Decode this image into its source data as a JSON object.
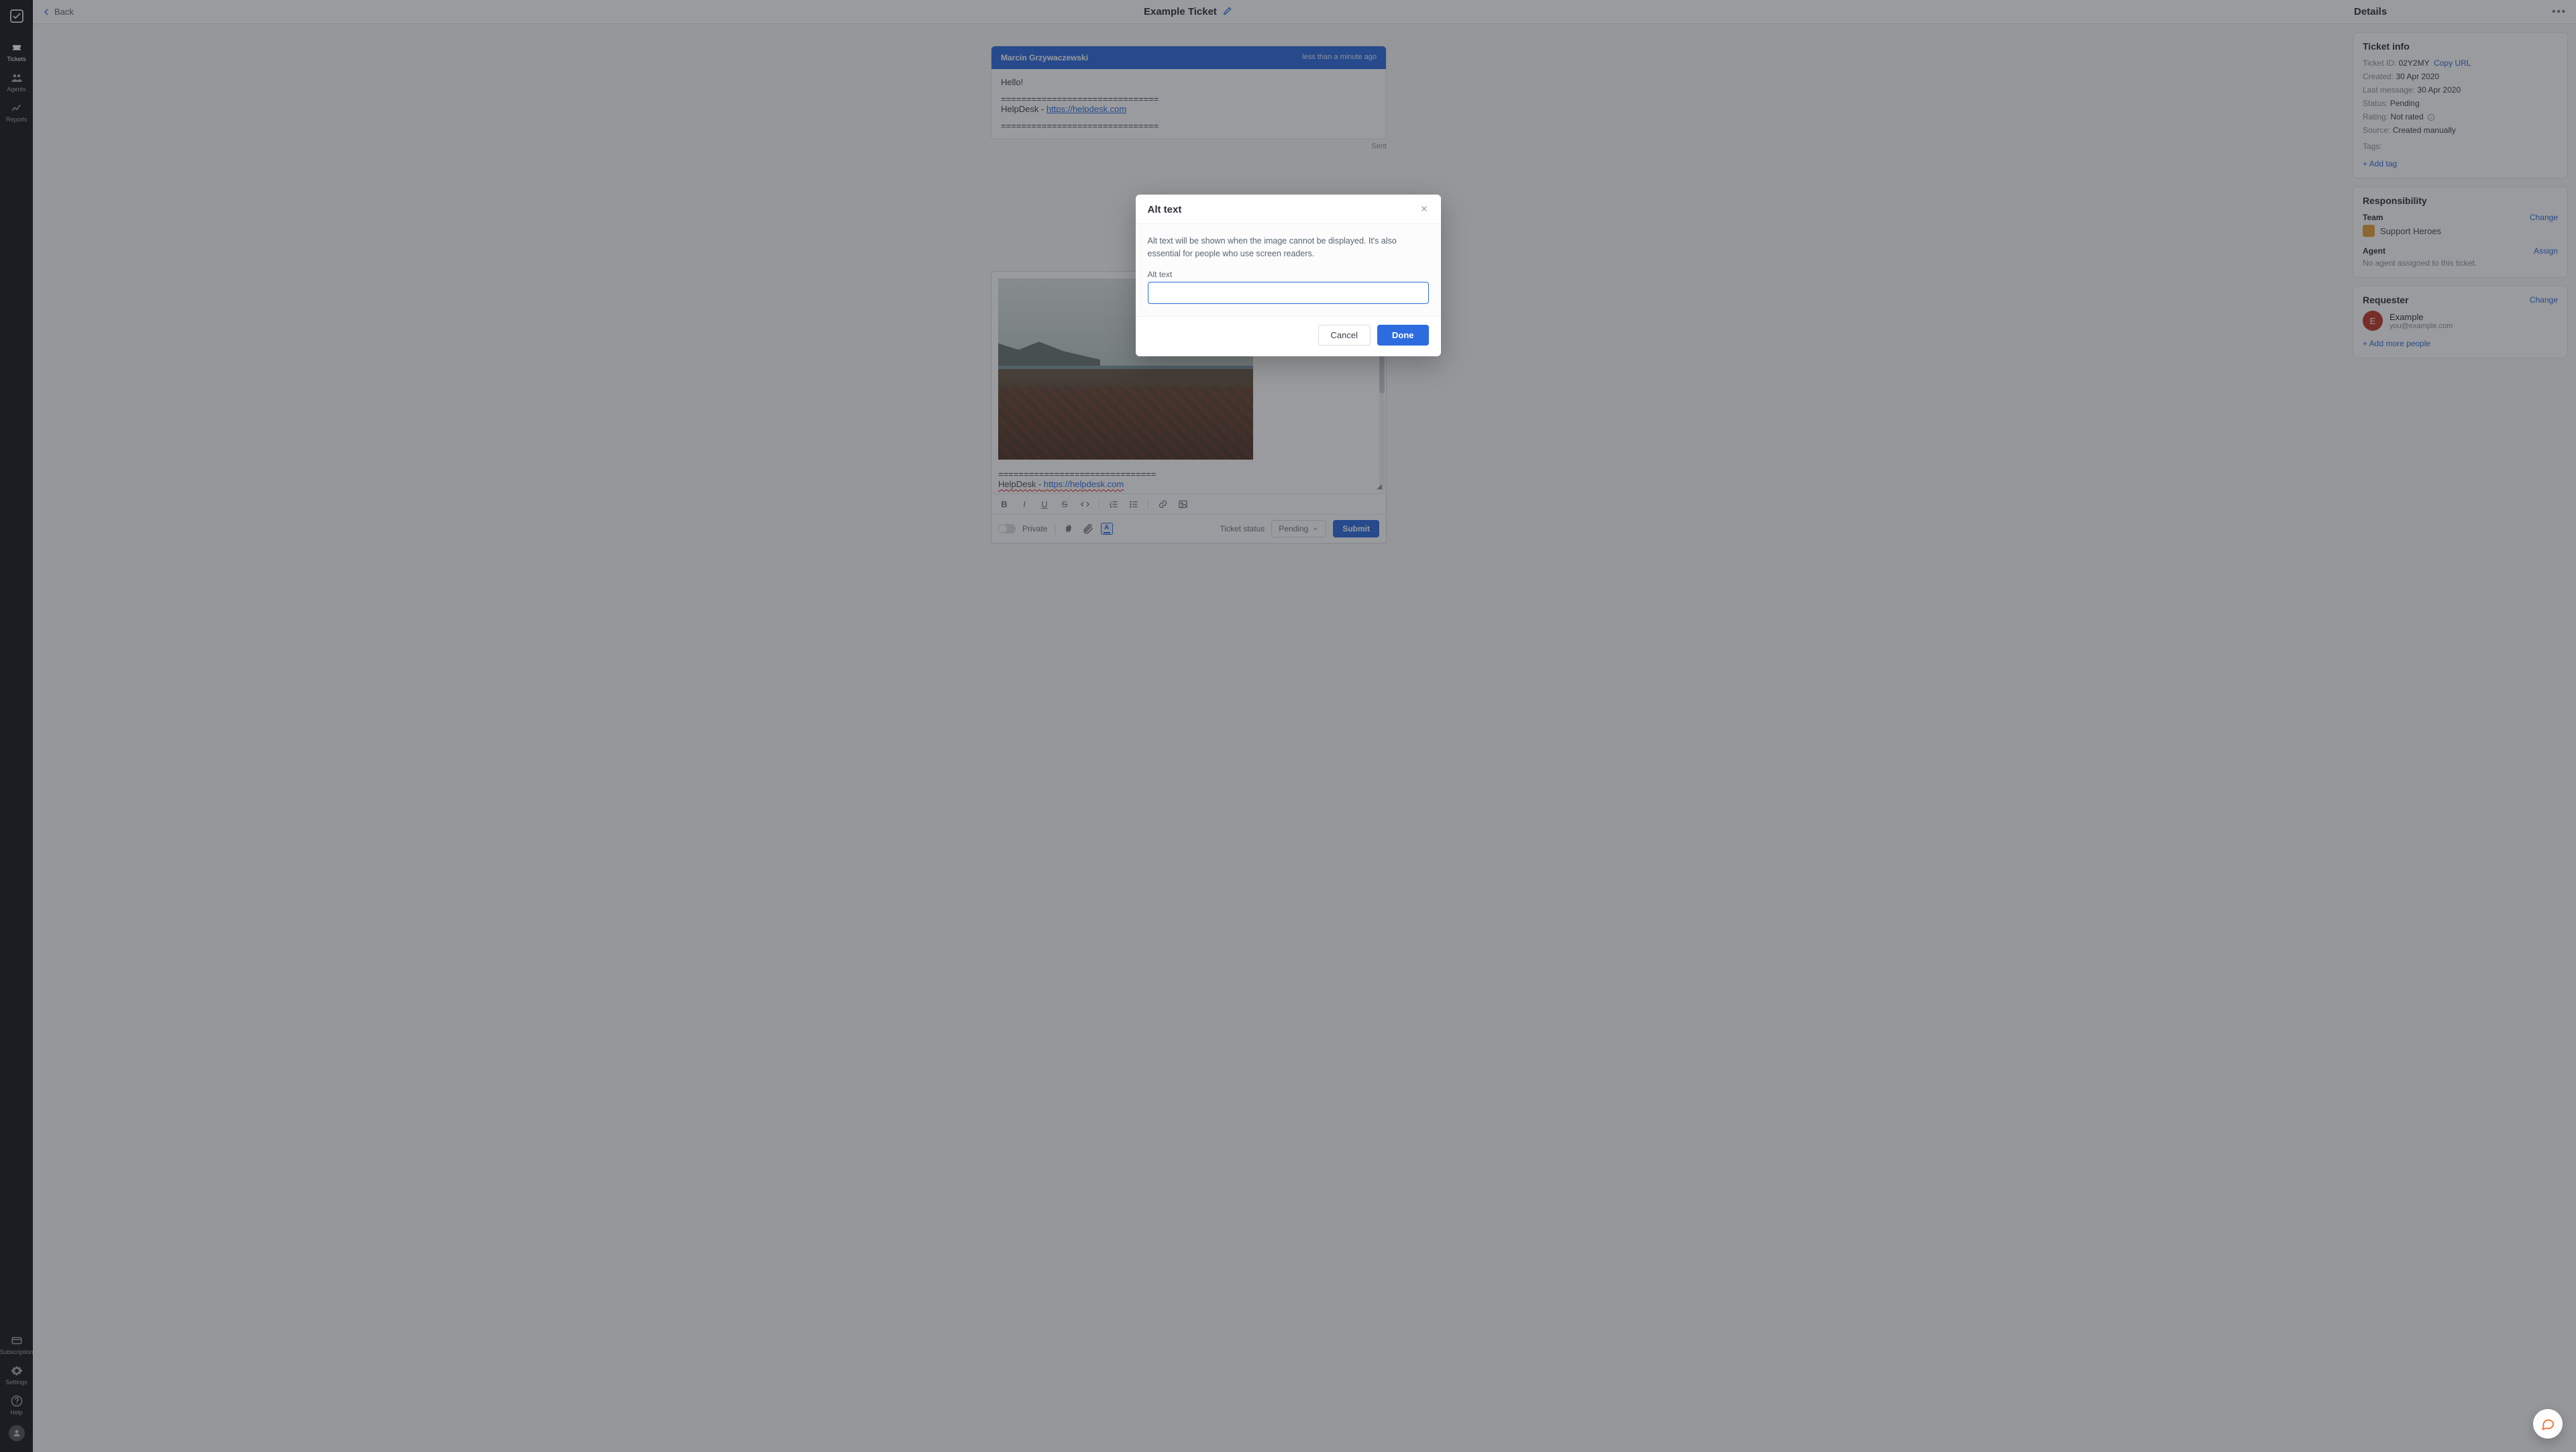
{
  "nav": {
    "items": [
      {
        "label": "Tickets"
      },
      {
        "label": "Agents"
      },
      {
        "label": "Reports"
      }
    ],
    "bottom": [
      {
        "label": "Subscription"
      },
      {
        "label": "Settings"
      },
      {
        "label": "Help"
      }
    ]
  },
  "topbar": {
    "back_label": "Back",
    "title": "Example Ticket"
  },
  "thread": {
    "author": "Marcin Grzywaczewski",
    "time": "less than a minute ago",
    "greeting": "Hello!",
    "sep": "===============================",
    "sig_prefix": "HelpDesk - ",
    "sig_link": "https://helpdesk.com",
    "sent_label": "Sent"
  },
  "composer": {
    "sig_sep": "===============================",
    "sig_prefix": "HelpDesk - ",
    "sig_link": "https://helpdesk.com",
    "private_label": "Private",
    "status_label": "Ticket status",
    "status_value": "Pending",
    "submit_label": "Submit"
  },
  "details": {
    "title": "Details",
    "ticket_info": {
      "heading": "Ticket info",
      "id_label": "Ticket ID:",
      "id_value": "02Y2MY",
      "copy_label": "Copy URL",
      "created_label": "Created:",
      "created_value": "30 Apr 2020",
      "last_label": "Last message:",
      "last_value": "30 Apr 2020",
      "status_label": "Status:",
      "status_value": "Pending",
      "rating_label": "Rating:",
      "rating_value": "Not rated",
      "source_label": "Source:",
      "source_value": "Created manually",
      "tags_label": "Tags:",
      "add_tag": "+ Add tag"
    },
    "responsibility": {
      "heading": "Responsibility",
      "team_label": "Team",
      "change_label": "Change",
      "team_name": "Support Heroes",
      "agent_label": "Agent",
      "assign_label": "Assign",
      "agent_empty": "No agent assigned to this ticket."
    },
    "requester": {
      "heading": "Requester",
      "change_label": "Change",
      "initial": "E",
      "name": "Example",
      "email": "you@example.com",
      "add_more": "+ Add more people"
    }
  },
  "modal": {
    "title": "Alt text",
    "description": "Alt text will be shown when the image cannot be displayed. It's also essential for people who use screen readers.",
    "input_label": "Alt text",
    "input_value": "",
    "cancel": "Cancel",
    "done": "Done"
  }
}
